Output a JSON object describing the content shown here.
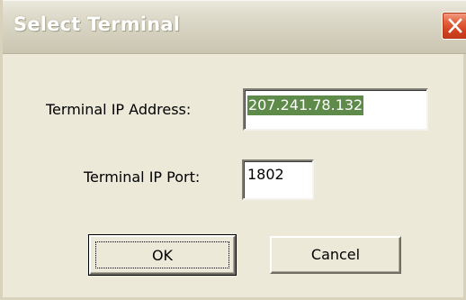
{
  "window": {
    "title": "Select Terminal",
    "close_icon": "close-x-icon"
  },
  "form": {
    "ip_label": "Terminal IP Address:",
    "ip_value": "207.241.78.132",
    "port_label": "Terminal IP Port:",
    "port_value": "1802"
  },
  "buttons": {
    "ok_label": "OK",
    "cancel_label": "Cancel"
  },
  "colors": {
    "title_bar": "#d5d1bf",
    "close_button": "#d0421f",
    "dialog_face": "#ece9d8",
    "selection_highlight": "#5e8b49"
  }
}
